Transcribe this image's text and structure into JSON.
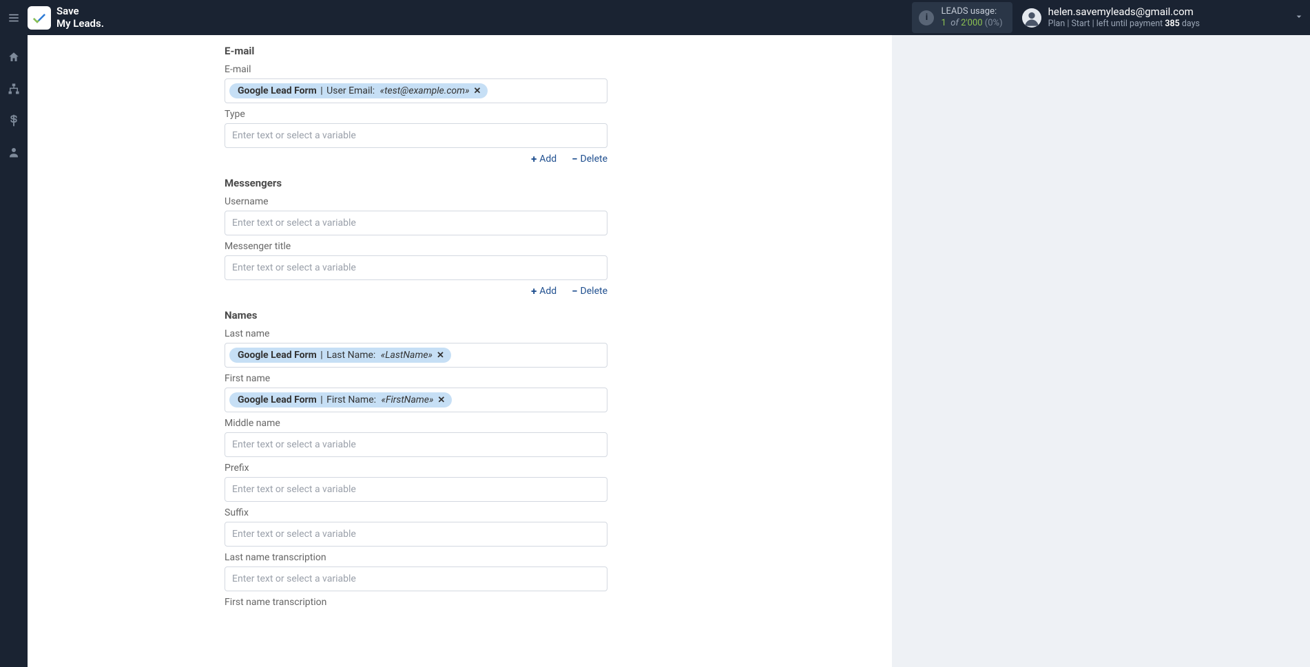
{
  "brand": {
    "line1": "Save",
    "line2": "My Leads."
  },
  "usage": {
    "title": "LEADS usage:",
    "current": "1",
    "of": "of",
    "total": "2'000",
    "pct": "(0%)"
  },
  "account": {
    "email": "helen.savemyleads@gmail.com",
    "plan_prefix": "Plan |",
    "plan_name": "Start",
    "left_prefix": "| left until payment",
    "days_num": "385",
    "days_label": "days"
  },
  "common": {
    "placeholder": "Enter text or select a variable",
    "add": "Add",
    "delete": "Delete"
  },
  "sections": {
    "email": {
      "title": "E-mail",
      "fields": {
        "email": {
          "label": "E-mail",
          "chip": {
            "source": "Google Lead Form",
            "name": "User Email:",
            "value": "«test@example.com»"
          }
        },
        "type": {
          "label": "Type"
        }
      }
    },
    "messengers": {
      "title": "Messengers",
      "fields": {
        "username": {
          "label": "Username"
        },
        "messenger_title": {
          "label": "Messenger title"
        }
      }
    },
    "names": {
      "title": "Names",
      "fields": {
        "last_name": {
          "label": "Last name",
          "chip": {
            "source": "Google Lead Form",
            "name": "Last Name:",
            "value": "«LastName»"
          }
        },
        "first_name": {
          "label": "First name",
          "chip": {
            "source": "Google Lead Form",
            "name": "First Name:",
            "value": "«FirstName»"
          }
        },
        "middle_name": {
          "label": "Middle name"
        },
        "prefix": {
          "label": "Prefix"
        },
        "suffix": {
          "label": "Suffix"
        },
        "last_name_trans": {
          "label": "Last name transcription"
        },
        "first_name_trans": {
          "label": "First name transcription"
        }
      }
    }
  }
}
